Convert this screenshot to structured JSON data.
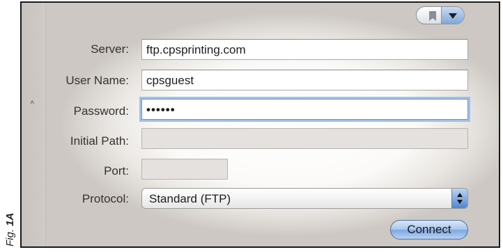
{
  "figure_label": {
    "prefix": "Fig. ",
    "number": "1A"
  },
  "toolbar": {
    "bookmark_icon": "bookmark-icon",
    "dropdown_icon": "chevron-down-icon"
  },
  "sidebar": {
    "collapse_icon": "chevron-up-icon",
    "collapse_glyph": "˄"
  },
  "form": {
    "server_label": "Server:",
    "server_value": "ftp.cpsprinting.com",
    "username_label": "User Name:",
    "username_value": "cpsguest",
    "password_label": "Password:",
    "password_value": "••••••",
    "initial_path_label": "Initial Path:",
    "initial_path_value": "",
    "port_label": "Port:",
    "port_value": "",
    "protocol_label": "Protocol:",
    "protocol_value": "Standard (FTP)",
    "connect_label": "Connect"
  },
  "colors": {
    "accent_blue": "#7ea7e0",
    "focus_ring": "#9fc1e8",
    "frame_border": "#1a1a1a"
  }
}
